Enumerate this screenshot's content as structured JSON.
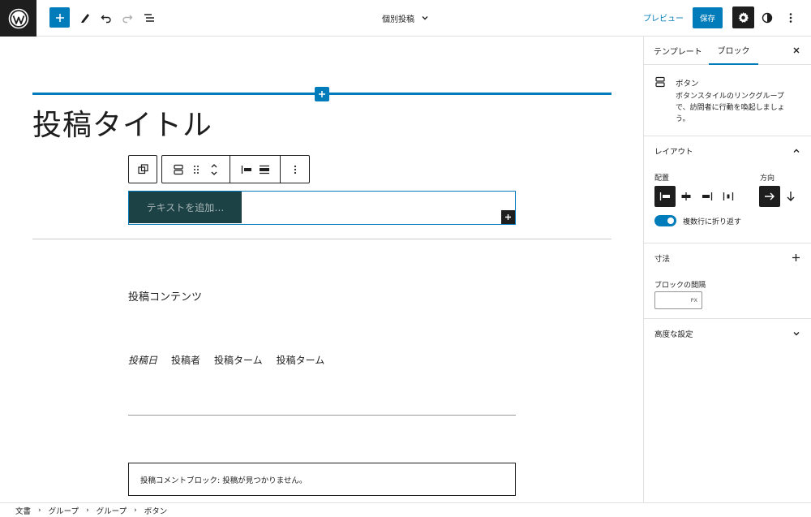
{
  "header": {
    "document_title": "個別投稿",
    "preview_label": "プレビュー",
    "save_label": "保存"
  },
  "canvas": {
    "post_title": "投稿タイトル",
    "button_placeholder": "テキストを追加…",
    "post_content": "投稿コンテンツ",
    "meta": {
      "date": "投稿日",
      "author": "投稿者",
      "term1": "投稿ターム",
      "term2": "投稿ターム"
    },
    "comments_notice": "投稿コメントブロック: 投稿が見つかりません。"
  },
  "sidebar": {
    "tabs": [
      {
        "label": "テンプレート"
      },
      {
        "label": "ブロック"
      }
    ],
    "block_card": {
      "name": "ボタン",
      "description": "ボタンスタイルのリンクグループで、訪問者に行動を喚起しましょう。"
    },
    "layout": {
      "title": "レイアウト",
      "justification_label": "配置",
      "orientation_label": "方向",
      "wrap_label": "複数行に折り返す"
    },
    "dimensions": {
      "title": "寸法",
      "block_spacing_label": "ブロックの間隔",
      "unit": "PX"
    },
    "advanced": {
      "title": "高度な設定"
    }
  },
  "breadcrumb": [
    "文書",
    "グループ",
    "グループ",
    "ボタン"
  ],
  "colors": {
    "accent": "#007cba",
    "button_bg": "#1d4246",
    "dark": "#1e1e1e"
  }
}
